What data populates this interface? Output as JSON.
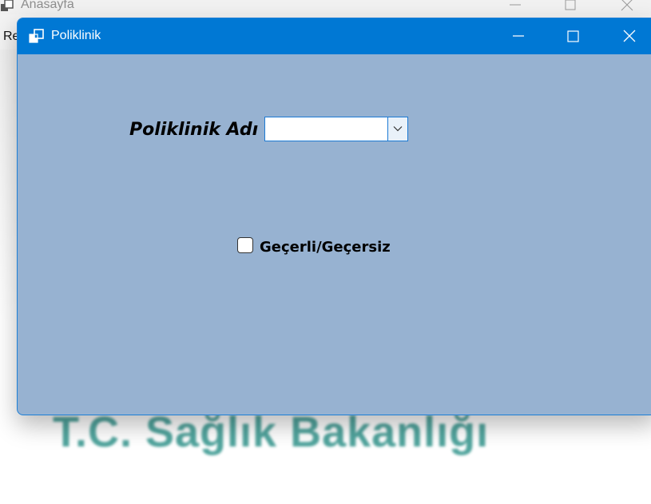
{
  "background_window": {
    "title": "Anasayfa",
    "menu_label": "Re",
    "watermark_text": "T.C. Sağlık Bakanlığı"
  },
  "dialog": {
    "title": "Poliklinik",
    "field_label": "Poliklinik Adı",
    "combo_value": "",
    "checkbox_label": "Geçerli/Geçersiz",
    "checkbox_checked": false
  },
  "colors": {
    "dialog_background": "#97b2d1",
    "titlebar": "#0078d4",
    "watermark": "#3e9b93"
  },
  "icons": [
    "app-icon",
    "minimize-icon",
    "maximize-icon",
    "close-icon",
    "chevron-down-icon"
  ]
}
